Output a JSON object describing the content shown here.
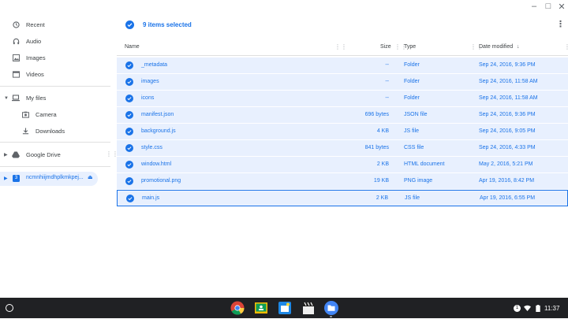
{
  "sidebar": {
    "recent": "Recent",
    "audio": "Audio",
    "images": "Images",
    "videos": "Videos",
    "my_files": "My files",
    "camera": "Camera",
    "downloads": "Downloads",
    "google_drive": "Google Drive",
    "usb_device": "ncmnhiijmdhplkmkpej..."
  },
  "header": {
    "selected_text": "9 items selected"
  },
  "columns": {
    "name": "Name",
    "size": "Size",
    "type": "Type",
    "date": "Date modified"
  },
  "files": [
    {
      "name": "_metadata",
      "size": "--",
      "type": "Folder",
      "date": "Sep 24, 2016, 9:36 PM"
    },
    {
      "name": "images",
      "size": "--",
      "type": "Folder",
      "date": "Sep 24, 2016, 11:58 AM"
    },
    {
      "name": "icons",
      "size": "--",
      "type": "Folder",
      "date": "Sep 24, 2016, 11:58 AM"
    },
    {
      "name": "manifest.json",
      "size": "696 bytes",
      "type": "JSON file",
      "date": "Sep 24, 2016, 9:36 PM"
    },
    {
      "name": "background.js",
      "size": "4 KB",
      "type": "JS file",
      "date": "Sep 24, 2016, 9:05 PM"
    },
    {
      "name": "style.css",
      "size": "841 bytes",
      "type": "CSS file",
      "date": "Sep 24, 2016, 4:33 PM"
    },
    {
      "name": "window.html",
      "size": "2 KB",
      "type": "HTML document",
      "date": "May 2, 2016, 5:21 PM"
    },
    {
      "name": "promotional.png",
      "size": "19 KB",
      "type": "PNG image",
      "date": "Apr 19, 2016, 8:42 PM"
    },
    {
      "name": "main.js",
      "size": "2 KB",
      "type": "JS file",
      "date": "Apr 19, 2016, 6:55 PM"
    }
  ],
  "shelf": {
    "apps": [
      "chrome-icon",
      "classroom-icon",
      "screencast-icon",
      "video-editor-icon",
      "files-app-icon"
    ]
  },
  "tray": {
    "notification_count": "1",
    "time": "11:37"
  },
  "colors": {
    "accent": "#1a73e8",
    "selected_row": "#e8f0fe",
    "shelf": "#202124"
  }
}
